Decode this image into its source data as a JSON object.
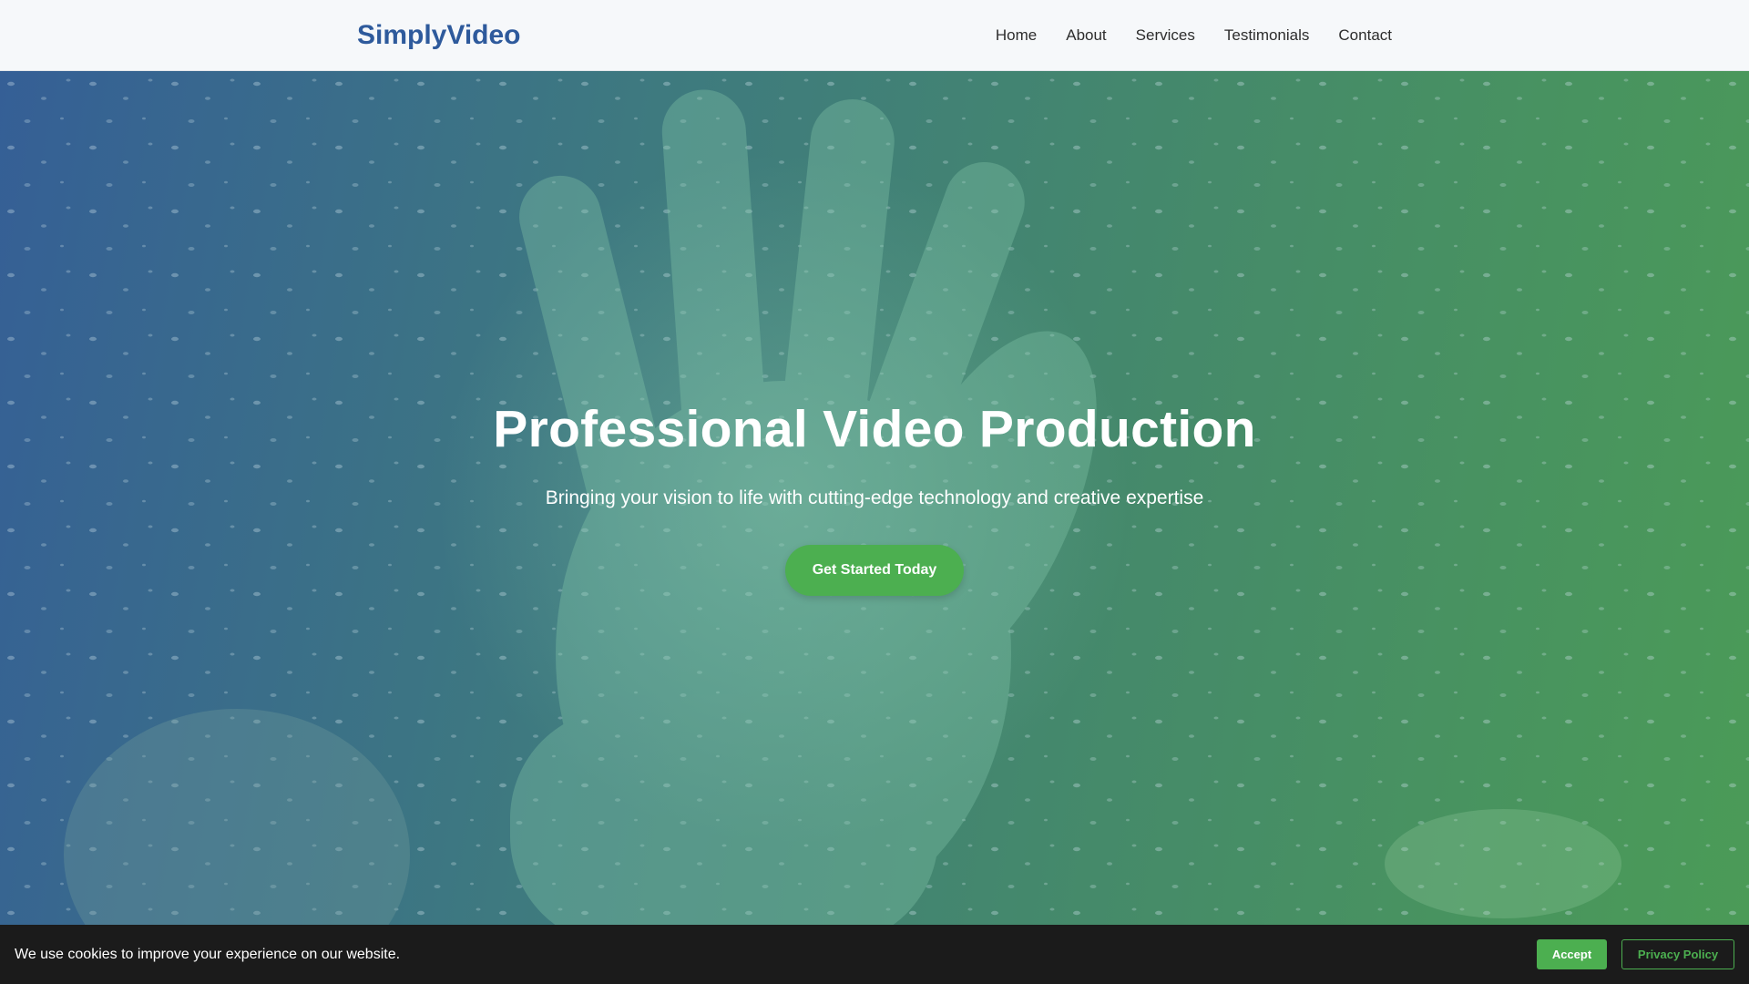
{
  "header": {
    "brand": "SimplyVideo",
    "nav": [
      {
        "label": "Home"
      },
      {
        "label": "About"
      },
      {
        "label": "Services"
      },
      {
        "label": "Testimonials"
      },
      {
        "label": "Contact"
      }
    ]
  },
  "hero": {
    "title": "Professional Video Production",
    "subtitle": "Bringing your vision to life with cutting-edge technology and creative expertise",
    "cta_label": "Get Started Today"
  },
  "cookie_banner": {
    "message": "We use cookies to improve your experience on our website.",
    "accept_label": "Accept",
    "privacy_label": "Privacy Policy"
  },
  "colors": {
    "brand": "#2e5a9c",
    "accent_green": "#4caf50",
    "header_bg": "#f6f8fa",
    "cookie_bg": "#1b1b1b"
  }
}
